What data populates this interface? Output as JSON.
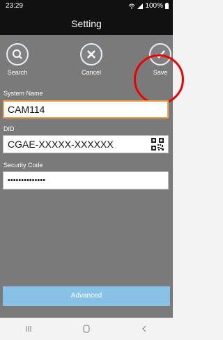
{
  "status_bar": {
    "time": "23:29",
    "battery": "100%"
  },
  "header": {
    "title": "Setting"
  },
  "actions": {
    "search_label": "Search",
    "cancel_label": "Cancel",
    "save_label": "Save"
  },
  "form": {
    "system_name": {
      "label": "System Name",
      "value": "CAM114"
    },
    "did": {
      "label": "DID",
      "value": "CGAE-XXXXX-XXXXXX"
    },
    "security_code": {
      "label": "Security Code",
      "value": "••••••••••••••"
    }
  },
  "advanced_label": "Advanced",
  "icons": [
    "wifi-icon",
    "signal-icon",
    "battery-icon",
    "search-icon",
    "close-icon",
    "check-icon",
    "qr-code-icon",
    "nav-recents-icon",
    "nav-home-icon",
    "nav-back-icon"
  ],
  "colors": {
    "annotation": "#e00000",
    "accent": "#87c2e6",
    "focus": "#f0a44a"
  }
}
